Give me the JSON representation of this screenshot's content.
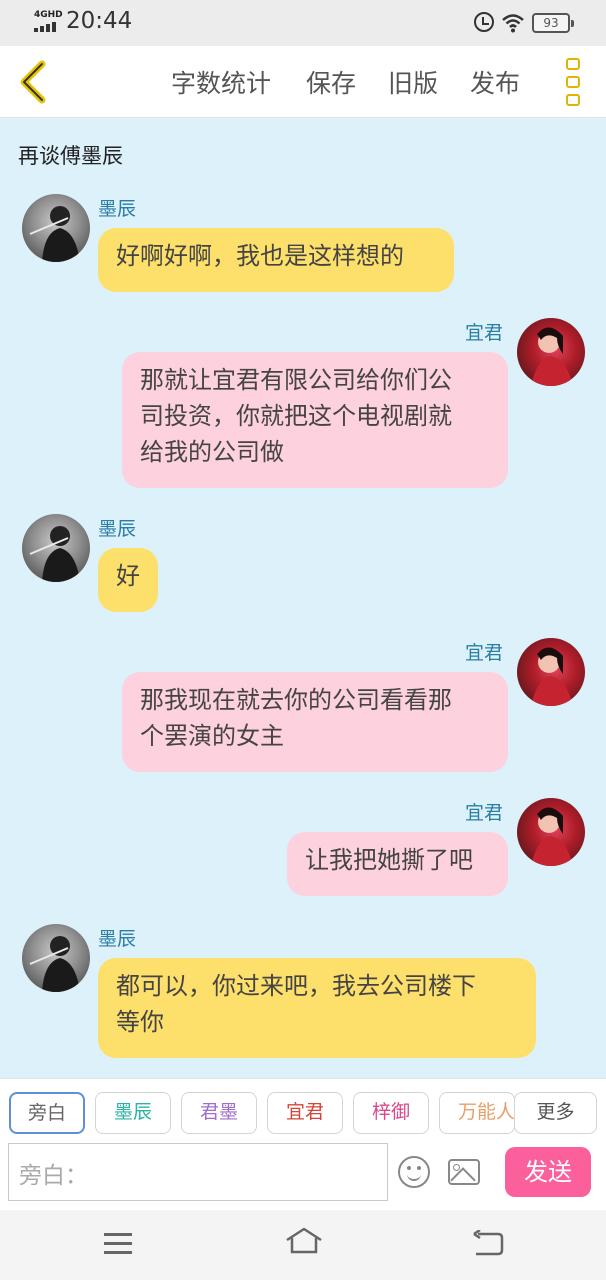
{
  "status_bar": {
    "network": "4GHD",
    "time": "20:44",
    "battery": "93"
  },
  "toolbar": {
    "actions": [
      "字数统计",
      "保存",
      "旧版",
      "发布"
    ]
  },
  "chat": {
    "title": "再谈傅墨辰",
    "messages": [
      {
        "sender": "墨辰",
        "side": "left",
        "color": "yellow",
        "lines": [
          "好啊好啊，我也是这样想的"
        ]
      },
      {
        "sender": "宜君",
        "side": "right",
        "color": "pink",
        "lines": [
          "那就让宜君有限公司给你们公",
          "司投资，你就把这个电视剧就",
          "给我的公司做"
        ]
      },
      {
        "sender": "墨辰",
        "side": "left",
        "color": "yellow",
        "lines": [
          "好"
        ]
      },
      {
        "sender": "宜君",
        "side": "right",
        "color": "pink",
        "lines": [
          "那我现在就去你的公司看看那",
          "个罢演的女主"
        ]
      },
      {
        "sender": "宜君",
        "side": "right",
        "color": "pink",
        "lines": [
          "让我把她撕了吧"
        ]
      },
      {
        "sender": "墨辰",
        "side": "left",
        "color": "yellow",
        "lines": [
          "都可以，你过来吧，我去公司楼下",
          "等你"
        ]
      }
    ]
  },
  "composer": {
    "roles": [
      {
        "label": "旁白",
        "color": "#666666"
      },
      {
        "label": "墨辰",
        "color": "#2bb3a6"
      },
      {
        "label": "君墨",
        "color": "#a26cc9"
      },
      {
        "label": "宜君",
        "color": "#d5453b"
      },
      {
        "label": "梓御",
        "color": "#d94a8c"
      },
      {
        "label": "万能人",
        "color": "#e8a06a"
      }
    ],
    "more_label": "更多",
    "input_placeholder": "旁白：",
    "send_label": "发送"
  }
}
